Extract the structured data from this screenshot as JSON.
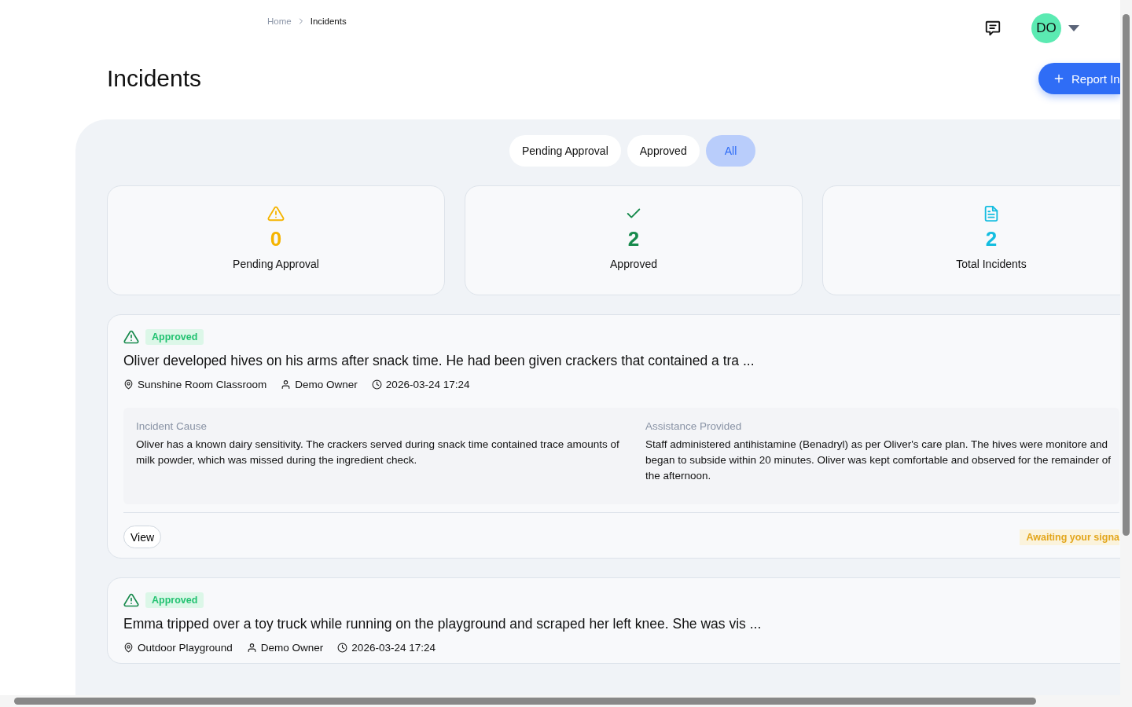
{
  "breadcrumb": [
    "Home",
    "Incidents"
  ],
  "user": {
    "initials": "DO"
  },
  "page_title": "Incidents",
  "primary_action": "Report In",
  "filters": [
    {
      "label": "Pending Approval",
      "selected": false
    },
    {
      "label": "Approved",
      "selected": false
    },
    {
      "label": "All",
      "selected": true
    }
  ],
  "stats": [
    {
      "kind": "pending",
      "value": "0",
      "label": "Pending Approval"
    },
    {
      "kind": "approved",
      "value": "2",
      "label": "Approved"
    },
    {
      "kind": "total",
      "value": "2",
      "label": "Total Incidents"
    }
  ],
  "incidents": [
    {
      "status": "Approved",
      "title": "Oliver developed hives on his arms after snack time. He had been given crackers that contained a tra ...",
      "location": "Sunshine Room Classroom",
      "reporter": "Demo Owner",
      "datetime": "2026-03-24 17:24",
      "details": [
        {
          "label": "Incident Cause",
          "text": "Oliver has a known dairy sensitivity. The crackers served during snack time contained trace amounts of milk powder, which was missed during the ingredient check."
        },
        {
          "label": "Assistance Provided",
          "text": "Staff administered antihistamine (Benadryl) as per Oliver's care plan. The hives were monitore and began to subside within 20 minutes. Oliver was kept comfortable and observed for the remainder of the afternoon."
        }
      ],
      "action": "View",
      "signature": "Awaiting your signa"
    },
    {
      "status": "Approved",
      "title": "Emma tripped over a toy truck while running on the playground and scraped her left knee. She was vis ...",
      "location": "Outdoor Playground",
      "reporter": "Demo Owner",
      "datetime": "2026-03-24 17:24"
    }
  ]
}
